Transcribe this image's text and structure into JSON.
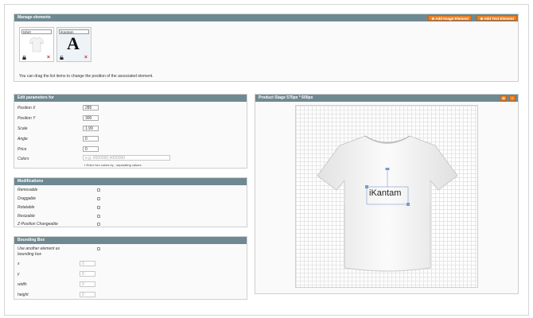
{
  "manage": {
    "title": "Manage elements",
    "add_image_label": "Add Image Element",
    "add_text_label": "Add Text Element",
    "elements": [
      {
        "name": "tshirt"
      },
      {
        "name": "iKantam",
        "glyph": "A"
      }
    ],
    "hint": "You can drag the list items to change the position of the associated element."
  },
  "edit": {
    "title": "Edit parameters for",
    "rows": [
      {
        "label": "Position X",
        "value": "285"
      },
      {
        "label": "Position Y",
        "value": "300"
      },
      {
        "label": "Scale",
        "value": "1.99"
      },
      {
        "label": "Angle",
        "value": "0"
      },
      {
        "label": "Price",
        "value": "0"
      }
    ],
    "colors_label": "Colors",
    "colors_placeholder": "e.g. #000000,#000000",
    "colors_hint": "Enter hex colors by , separating values."
  },
  "modifications": {
    "title": "Modifications",
    "items": [
      "Removable",
      "Draggable",
      "Rotatable",
      "Resizable",
      "Z-Position Changeable"
    ]
  },
  "bounding": {
    "title": "Bounding Box",
    "use_other_label": "Use another element as bounding box",
    "fields": [
      {
        "label": "x",
        "value": "0"
      },
      {
        "label": "y",
        "value": "0"
      },
      {
        "label": "width",
        "value": "0"
      },
      {
        "label": "height",
        "value": "0"
      }
    ]
  },
  "stage": {
    "title": "Product Stage 570px * 600px",
    "text_element": "iKantam"
  },
  "colors": {
    "header_bg": "#6f8992",
    "accent_orange": "#eb8125",
    "delete_red": "#d9252a"
  }
}
